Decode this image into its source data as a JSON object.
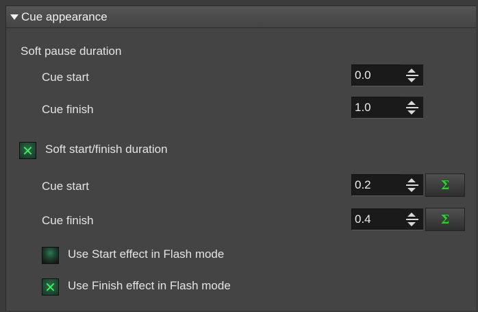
{
  "section": {
    "title": "Cue appearance"
  },
  "soft_pause": {
    "label": "Soft pause duration",
    "cue_start": {
      "label": "Cue start",
      "value": "0.0"
    },
    "cue_finish": {
      "label": "Cue finish",
      "value": "1.0"
    }
  },
  "soft_start_finish": {
    "label": "Soft start/finish duration",
    "checked": true,
    "cue_start": {
      "label": "Cue start",
      "value": "0.2",
      "sigma": "Σ"
    },
    "cue_finish": {
      "label": "Cue finish",
      "value": "0.4",
      "sigma": "Σ"
    }
  },
  "flash": {
    "use_start": {
      "label": "Use Start effect in  Flash mode",
      "checked": false
    },
    "use_finish": {
      "label": "Use Finish effect in  Flash mode",
      "checked": true,
      "mark": "✕"
    }
  },
  "colors": {
    "panel_bg": "#444444",
    "field_bg": "#1a1a1a",
    "check_green": "#3cf05a",
    "sigma_green": "#2ecc2e"
  },
  "icons": {
    "expand": "triangle-down-icon",
    "spin": "spin-arrows-icon",
    "sum": "sigma-icon",
    "check": "check-x-icon"
  }
}
